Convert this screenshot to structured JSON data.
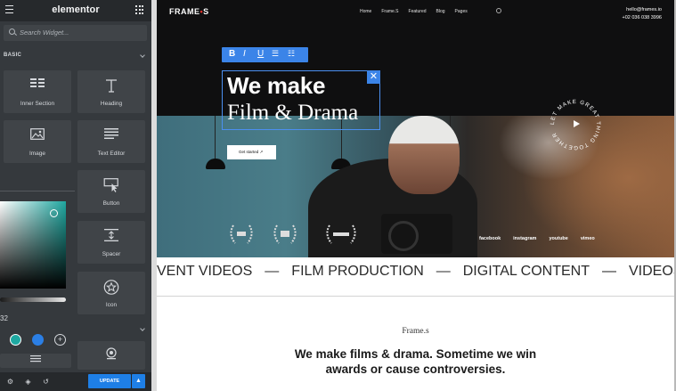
{
  "editor": {
    "brand": "elementor",
    "search": {
      "placeholder": "Search Widget..."
    },
    "category": "BASIC",
    "widgets": [
      {
        "label": "Inner Section",
        "icon": "inner-section-icon"
      },
      {
        "label": "Heading",
        "icon": "heading-icon"
      },
      {
        "label": "Image",
        "icon": "image-icon"
      },
      {
        "label": "Text Editor",
        "icon": "text-editor-icon"
      },
      {
        "label": "Button",
        "icon": "button-icon"
      },
      {
        "label": "Spacer",
        "icon": "spacer-icon"
      },
      {
        "label": "Icon",
        "icon": "star-icon"
      }
    ],
    "color_picker": {
      "value": "32",
      "swatches": [
        "#1ea8a1",
        "#2b7fe5"
      ],
      "add_label": "+"
    },
    "footer": {
      "update_label": "UPDATE",
      "dropdown_label": "▲"
    }
  },
  "site": {
    "logo": "FRAME",
    "logo_mark": "•",
    "logo_suffix": "S",
    "nav": [
      "Home",
      "Frame.S",
      "Featured",
      "Blog",
      "Pages"
    ],
    "contact_email": "hello@frames.io",
    "contact_phone": "+02 036 038 3996",
    "headline_line1": "We make",
    "headline_line2": "Film & Drama",
    "format_buttons": [
      "B",
      "I",
      "U",
      "☰",
      "☷"
    ],
    "close_label": "✕",
    "cta_label": "Get started ↗",
    "badge_text": "LET MAKE GREAT THING TOGETHER",
    "socials": [
      "facebook",
      "instagram",
      "youtube",
      "vimeo"
    ],
    "ticker": [
      "VENT VIDEOS",
      "—",
      "FILM PRODUCTION",
      "—",
      "DIGITAL CONTENT",
      "—",
      "VIDEOS SOLU"
    ],
    "about_brand": "Frame.s",
    "tagline_line1": "We make films & drama. Sometime we win",
    "tagline_line2": "awards or cause controversies."
  },
  "colors": {
    "sidebar_bg": "#35393d",
    "accent_blue": "#1e7fe6",
    "selection_blue": "#3b84e8",
    "logo_dot_red": "#e2312a"
  }
}
